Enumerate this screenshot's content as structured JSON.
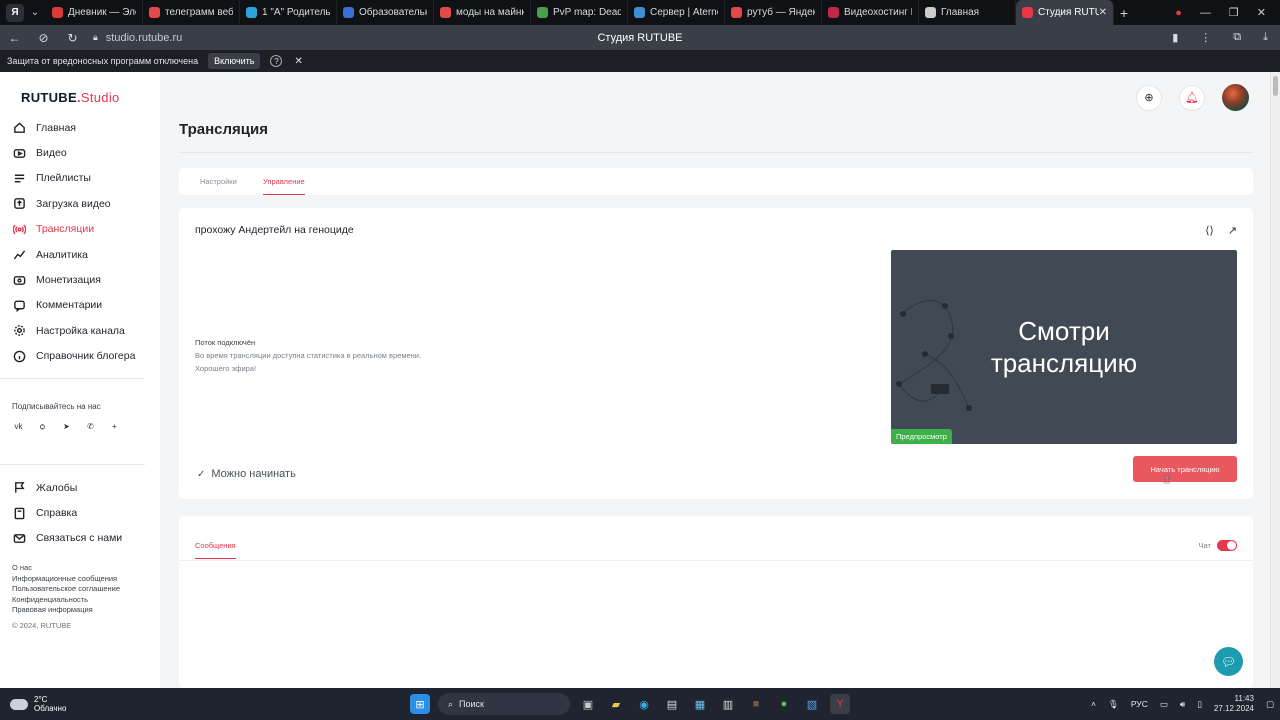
{
  "browser": {
    "tabs": [
      {
        "label": "Дневник — Эле",
        "color": "#d93a3a"
      },
      {
        "label": "телеграмм веб",
        "color": "#e24a4a"
      },
      {
        "label": "1 \"А\" Родитель",
        "color": "#2aa3d6"
      },
      {
        "label": "Образовательн",
        "color": "#3b6ed6"
      },
      {
        "label": "моды на майнк",
        "color": "#e24a4a"
      },
      {
        "label": "PvP map: Dead c",
        "color": "#4aa04a"
      },
      {
        "label": "Сервер | Aterno",
        "color": "#3b8fd6"
      },
      {
        "label": "рутуб — Яндекс",
        "color": "#e24a4a"
      },
      {
        "label": "Видеохостинг R",
        "color": "#c0284a"
      },
      {
        "label": "Главная",
        "color": "#cccccc"
      },
      {
        "label": "Студия RUTUB",
        "color": "#e8364a"
      }
    ],
    "url": "studio.rutube.ru",
    "page_title": "Студия RUTUBE",
    "protection_text": "Защита от вредоносных программ отключена",
    "protection_button": "Включить"
  },
  "logo": {
    "brand": "RUTUBE",
    "dot": ".",
    "product": "Studio"
  },
  "sidebar": {
    "items": [
      {
        "label": "Главная",
        "icon": "home-icon"
      },
      {
        "label": "Видео",
        "icon": "video-icon"
      },
      {
        "label": "Плейлисты",
        "icon": "playlist-icon"
      },
      {
        "label": "Загрузка видео",
        "icon": "upload-icon"
      },
      {
        "label": "Трансляции",
        "icon": "broadcast-icon",
        "active": true
      },
      {
        "label": "Аналитика",
        "icon": "analytics-icon"
      },
      {
        "label": "Монетизация",
        "icon": "monetization-icon"
      },
      {
        "label": "Комментарии",
        "icon": "comments-icon"
      },
      {
        "label": "Настройка канала",
        "icon": "settings-icon"
      },
      {
        "label": "Справочник блогера",
        "icon": "info-icon"
      }
    ],
    "subscribe_label": "Подписывайтесь на нас",
    "socials": [
      "vk",
      "ok",
      "telegram",
      "viber",
      "more"
    ],
    "secondary": [
      {
        "label": "Жалобы",
        "icon": "flag-icon"
      },
      {
        "label": "Справка",
        "icon": "book-icon"
      },
      {
        "label": "Связаться с нами",
        "icon": "mail-icon"
      }
    ],
    "footer_links": [
      "О нас",
      "Информационные сообщения",
      "Пользовательское соглашение",
      "Конфиденциальность",
      "Правовая информация"
    ],
    "copyright": "© 2024, RUTUBE"
  },
  "page": {
    "title": "Трансляция",
    "tabs": [
      {
        "label": "Настройки"
      },
      {
        "label": "Управление",
        "active": true
      }
    ],
    "stream_title": "прохожу Андертейл на геноциде",
    "status_lines": [
      "Поток подключён",
      "Во время трансляции доступна статистика в реальном времени.",
      "Хорошего эфира!"
    ],
    "ready_label": "Можно начинать",
    "preview_text_1": "Смотри",
    "preview_text_2": "трансляцию",
    "preview_badge": "Предпросмотр",
    "start_button": "Начать трансляцию",
    "chat_tab": "Сообщения",
    "chat_toggle_label": "Чат",
    "chat_enabled": true
  },
  "taskbar": {
    "temperature": "2°C",
    "weather": "Облачно",
    "search_placeholder": "Поиск",
    "language": "РУС",
    "time": "11:43",
    "date": "27.12.2024"
  },
  "colors": {
    "accent": "#e8364a",
    "button": "#e8585f",
    "preview_bg": "#414a54",
    "badge": "#3db04a",
    "support": "#1d9bb0"
  }
}
